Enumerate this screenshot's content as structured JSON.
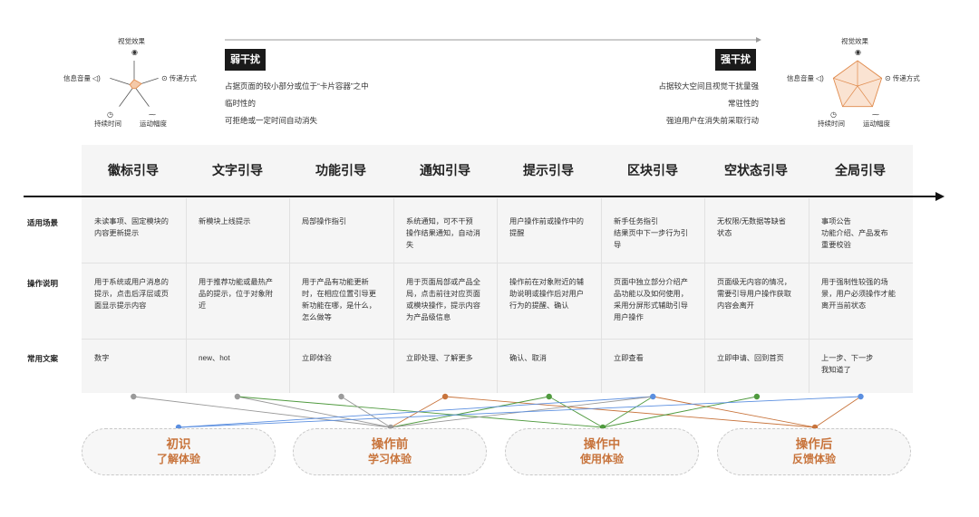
{
  "left_radar": {
    "labels": [
      "视觉效果",
      "传递方式",
      "运动幅度",
      "持续时间",
      "信息音量"
    ],
    "icons": [
      "eye-icon",
      "broadcast-icon",
      "wave-icon",
      "clock-icon",
      "speaker-icon"
    ],
    "values": [
      0.25,
      0.3,
      0.12,
      0.12,
      0.18
    ],
    "fill_color": "#f4c9a9"
  },
  "right_radar": {
    "labels": [
      "视觉效果",
      "传递方式",
      "运动幅度",
      "持续时间",
      "信息音量"
    ],
    "icons": [
      "eye-icon",
      "broadcast-icon",
      "wave-icon",
      "clock-icon",
      "speaker-icon"
    ],
    "values": [
      1,
      1,
      1,
      1,
      1
    ],
    "fill_color": "#fae3d2"
  },
  "weak": {
    "tag": "弱干扰",
    "lines": [
      "占据页面的较小部分或位于“卡片容器”之中",
      "临时性的",
      "可拒绝或一定时间自动消失"
    ]
  },
  "strong": {
    "tag": "强干扰",
    "lines": [
      "占据较大空间且视觉干扰量强",
      "常驻性的",
      "强迫用户在消失前采取行动"
    ]
  },
  "columns": [
    "徽标引导",
    "文字引导",
    "功能引导",
    "通知引导",
    "提示引导",
    "区块引导",
    "空状态引导",
    "全局引导"
  ],
  "rows": [
    {
      "label": "适用场景",
      "cells": [
        "未读事项、固定模块的\n内容更新提示",
        "新模块上线提示",
        "局部操作指引",
        "系统通知，可不干预\n操作结果通知，自动消\n失",
        "用户操作前或操作中的\n提醒",
        "新手任务指引\n结果页中下一步行为引\n导",
        "无权限/无数据等缺省\n状态",
        "事项公告\n功能介绍、产品发布\n重要校验"
      ]
    },
    {
      "label": "操作说明",
      "cells": [
        "用于系统或用户消息的\n提示，点击后浮层或页\n面显示提示内容",
        "用于推荐功能或最热产\n品的提示，位于对象附\n近",
        "用于产品有功能更新\n时，在相应位置引导更\n新功能在哪，是什么，\n怎么做等",
        "用于页面局部或产品全\n局，点击前往对应页面\n或模块操作，提示内容\n为产品级信息",
        "操作前在对象附近的辅\n助说明或操作后对用户\n行为的提醒、确认",
        "页面中独立部分介绍产\n品功能以及如何使用，\n采用分屏形式辅助引导\n用户操作",
        "页面级无内容的情况，\n需要引导用户操作获取\n内容会离开",
        "用于强制性较强的场\n景，用户必须操作才能\n离开当前状态"
      ]
    },
    {
      "label": "常用文案",
      "cells": [
        "数字",
        "new、hot",
        "立即体验",
        "立即处理、了解更多",
        "确认、取消",
        "立即查看",
        "立即申请、回到首页",
        "上一步、下一步\n我知道了"
      ]
    }
  ],
  "stages": [
    {
      "title": "初识",
      "sub": "了解体验"
    },
    {
      "title": "操作前",
      "sub": "学习体验"
    },
    {
      "title": "操作中",
      "sub": "使用体验"
    },
    {
      "title": "操作后",
      "sub": "反馈体验"
    }
  ],
  "connections": [
    {
      "from": 0,
      "to": 1,
      "color": "#9a9a9a"
    },
    {
      "from": 1,
      "to": 1,
      "color": "#9a9a9a"
    },
    {
      "from": 1,
      "to": 2,
      "color": "#4f9a3e"
    },
    {
      "from": 2,
      "to": 1,
      "color": "#9a9a9a"
    },
    {
      "from": 3,
      "to": 1,
      "color": "#c8743c"
    },
    {
      "from": 3,
      "to": 3,
      "color": "#c8743c"
    },
    {
      "from": 4,
      "to": 1,
      "color": "#4f9a3e"
    },
    {
      "from": 4,
      "to": 2,
      "color": "#4f9a3e"
    },
    {
      "from": 5,
      "to": 0,
      "color": "#5b8fe0"
    },
    {
      "from": 5,
      "to": 1,
      "color": "#9a9a9a"
    },
    {
      "from": 5,
      "to": 3,
      "color": "#c8743c"
    },
    {
      "from": 5,
      "to": 2,
      "color": "#4f9a3e"
    },
    {
      "from": 6,
      "to": 2,
      "color": "#4f9a3e"
    },
    {
      "from": 7,
      "to": 0,
      "color": "#5b8fe0"
    },
    {
      "from": 7,
      "to": 3,
      "color": "#c8743c"
    }
  ],
  "colors": {
    "accent": "#c8743c",
    "green": "#4f9a3e",
    "blue": "#5b8fe0",
    "gray": "#9a9a9a"
  }
}
